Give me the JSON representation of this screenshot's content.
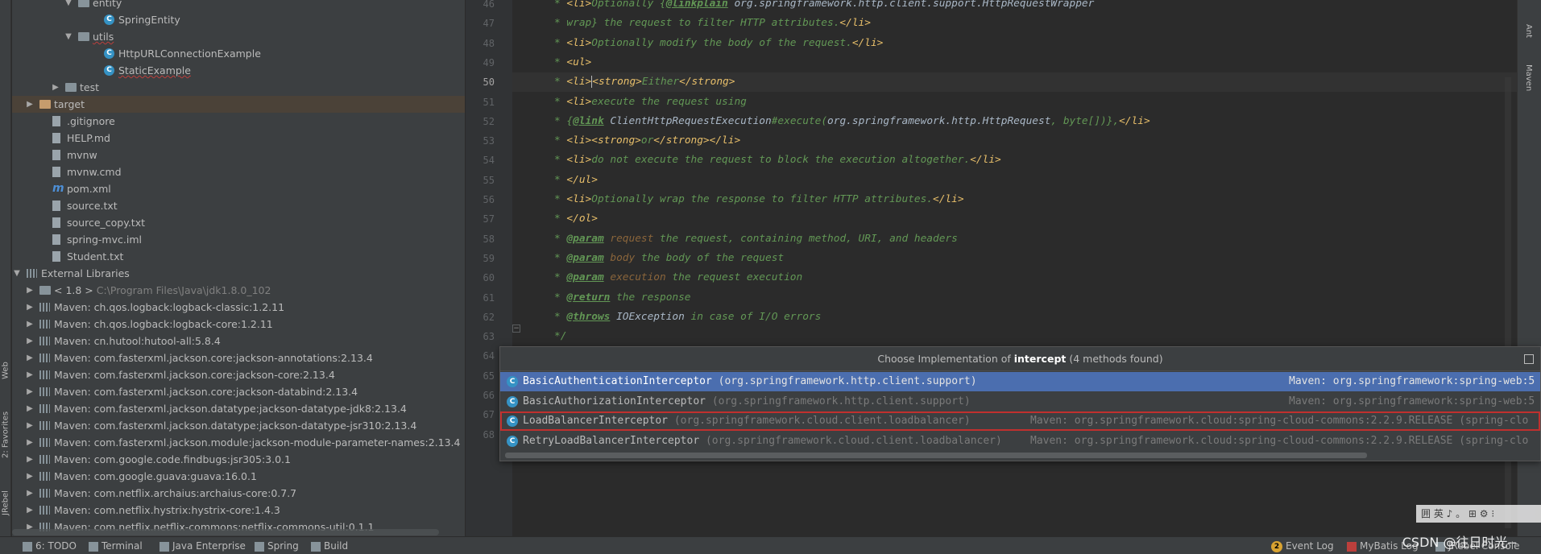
{
  "left_strip": {
    "tabs": [
      "Web",
      "2: Favorites",
      "JRebel"
    ]
  },
  "project_tree": {
    "rows": [
      {
        "label": "entity",
        "type": "folder",
        "indent": 4,
        "arrow": "▼"
      },
      {
        "label": "SpringEntity",
        "type": "class",
        "indent": 6,
        "arrow": ""
      },
      {
        "label": "utils",
        "type": "folder",
        "indent": 4,
        "arrow": "▼"
      },
      {
        "label": "HttpURLConnectionExample",
        "type": "class",
        "indent": 6,
        "arrow": ""
      },
      {
        "label": "StaticExample",
        "type": "class",
        "indent": 6,
        "arrow": ""
      },
      {
        "label": "test",
        "type": "folder",
        "indent": 3,
        "arrow": "▶"
      },
      {
        "label": "target",
        "type": "folder-orange",
        "indent": 1,
        "arrow": "▶"
      },
      {
        "label": ".gitignore",
        "type": "file",
        "indent": 2,
        "arrow": ""
      },
      {
        "label": "HELP.md",
        "type": "file",
        "indent": 2,
        "arrow": ""
      },
      {
        "label": "mvnw",
        "type": "file",
        "indent": 2,
        "arrow": ""
      },
      {
        "label": "mvnw.cmd",
        "type": "file",
        "indent": 2,
        "arrow": ""
      },
      {
        "label": "pom.xml",
        "type": "maven",
        "indent": 2,
        "arrow": ""
      },
      {
        "label": "source.txt",
        "type": "file",
        "indent": 2,
        "arrow": ""
      },
      {
        "label": "source_copy.txt",
        "type": "file",
        "indent": 2,
        "arrow": ""
      },
      {
        "label": "spring-mvc.iml",
        "type": "file",
        "indent": 2,
        "arrow": ""
      },
      {
        "label": "Student.txt",
        "type": "file",
        "indent": 2,
        "arrow": ""
      },
      {
        "label": "External Libraries",
        "type": "lib",
        "indent": 0,
        "arrow": "▼"
      },
      {
        "label": "< 1.8 >",
        "type": "folder",
        "indent": 1,
        "arrow": "▶",
        "extra": "C:\\Program Files\\Java\\jdk1.8.0_102"
      },
      {
        "label": "Maven: ch.qos.logback:logback-classic:1.2.11",
        "type": "lib2",
        "indent": 1,
        "arrow": "▶"
      },
      {
        "label": "Maven: ch.qos.logback:logback-core:1.2.11",
        "type": "lib2",
        "indent": 1,
        "arrow": "▶"
      },
      {
        "label": "Maven: cn.hutool:hutool-all:5.8.4",
        "type": "lib2",
        "indent": 1,
        "arrow": "▶"
      },
      {
        "label": "Maven: com.fasterxml.jackson.core:jackson-annotations:2.13.4",
        "type": "lib2",
        "indent": 1,
        "arrow": "▶"
      },
      {
        "label": "Maven: com.fasterxml.jackson.core:jackson-core:2.13.4",
        "type": "lib2",
        "indent": 1,
        "arrow": "▶"
      },
      {
        "label": "Maven: com.fasterxml.jackson.core:jackson-databind:2.13.4",
        "type": "lib2",
        "indent": 1,
        "arrow": "▶"
      },
      {
        "label": "Maven: com.fasterxml.jackson.datatype:jackson-datatype-jdk8:2.13.4",
        "type": "lib2",
        "indent": 1,
        "arrow": "▶"
      },
      {
        "label": "Maven: com.fasterxml.jackson.datatype:jackson-datatype-jsr310:2.13.4",
        "type": "lib2",
        "indent": 1,
        "arrow": "▶"
      },
      {
        "label": "Maven: com.fasterxml.jackson.module:jackson-module-parameter-names:2.13.4",
        "type": "lib2",
        "indent": 1,
        "arrow": "▶"
      },
      {
        "label": "Maven: com.google.code.findbugs:jsr305:3.0.1",
        "type": "lib2",
        "indent": 1,
        "arrow": "▶"
      },
      {
        "label": "Maven: com.google.guava:guava:16.0.1",
        "type": "lib2",
        "indent": 1,
        "arrow": "▶"
      },
      {
        "label": "Maven: com.netflix.archaius:archaius-core:0.7.7",
        "type": "lib2",
        "indent": 1,
        "arrow": "▶"
      },
      {
        "label": "Maven: com.netflix.hystrix:hystrix-core:1.4.3",
        "type": "lib2",
        "indent": 1,
        "arrow": "▶"
      },
      {
        "label": "Maven: com.netflix.netflix-commons:netflix-commons-util:0.1.1",
        "type": "lib2",
        "indent": 1,
        "arrow": "▶"
      }
    ]
  },
  "editor": {
    "lines": [
      {
        "n": "46",
        "html": "* <span class='tag'>&lt;li&gt;</span>Optionally {<span class='link'>@linkplain</span> <span class='ref'>org.springframework.http.client.support.HttpRequestWrapper</span>"
      },
      {
        "n": "47",
        "html": "* wrap} the request to filter HTTP attributes.<span class='tag'>&lt;/li&gt;</span>"
      },
      {
        "n": "48",
        "html": "* <span class='tag'>&lt;li&gt;</span>Optionally modify the body of the request.<span class='tag'>&lt;/li&gt;</span>"
      },
      {
        "n": "49",
        "html": "* <span class='tag'>&lt;ul&gt;</span>"
      },
      {
        "n": "50",
        "html": "* <span class='tag'>&lt;li&gt;</span><span class='cursor'></span><span class='tag'>&lt;strong&gt;</span>Either<span class='tag'>&lt;/strong&gt;</span>",
        "current": true
      },
      {
        "n": "51",
        "html": "* <span class='tag'>&lt;li&gt;</span>execute the request using"
      },
      {
        "n": "52",
        "html": "* {<span class='link'>@link</span> <span class='ref'>ClientHttpRequestExecution</span>#execute(<span class='ref'>org.springframework.http.HttpRequest</span>, byte[])},<span class='tag'>&lt;/li&gt;</span>"
      },
      {
        "n": "53",
        "html": "* <span class='tag'>&lt;li&gt;&lt;strong&gt;</span>or<span class='tag'>&lt;/strong&gt;&lt;/li&gt;</span>"
      },
      {
        "n": "54",
        "html": "* <span class='tag'>&lt;li&gt;</span>do not execute the request to block the execution altogether.<span class='tag'>&lt;/li&gt;</span>"
      },
      {
        "n": "55",
        "html": "* <span class='tag'>&lt;/ul&gt;</span>"
      },
      {
        "n": "56",
        "html": "* <span class='tag'>&lt;li&gt;</span>Optionally wrap the response to filter HTTP attributes.<span class='tag'>&lt;/li&gt;</span>"
      },
      {
        "n": "57",
        "html": "* <span class='tag'>&lt;/ol&gt;</span>"
      },
      {
        "n": "58",
        "html": "* <span class='kw'>@param</span> <span class='pname'>request</span> the request, containing method, URI, and headers"
      },
      {
        "n": "59",
        "html": "* <span class='kw'>@param</span> <span class='pname'>body</span> the body of the request"
      },
      {
        "n": "60",
        "html": "* <span class='kw'>@param</span> <span class='pname'>execution</span> the request execution"
      },
      {
        "n": "61",
        "html": "* <span class='kw'>@return</span> the response"
      },
      {
        "n": "62",
        "html": "* <span class='kw'>@throws</span> <span class='ref'>IOException</span> in case of I/O errors"
      },
      {
        "n": "63",
        "html": "*/"
      },
      {
        "n": "64",
        "html": ""
      },
      {
        "n": "65",
        "html": ""
      },
      {
        "n": "66",
        "html": ""
      },
      {
        "n": "67",
        "html": ""
      },
      {
        "n": "68",
        "html": ""
      }
    ]
  },
  "right_strip": {
    "tabs": [
      "Ant",
      "Maven"
    ]
  },
  "popup": {
    "title_prefix": "Choose Implementation of ",
    "title_method": "intercept",
    "title_suffix": " (4 methods found)",
    "items": [
      {
        "name": "BasicAuthenticationInterceptor",
        "pkg": "(org.springframework.http.client.support)",
        "source": "Maven: org.springframework:spring-web:5",
        "selected": true,
        "boxed": false
      },
      {
        "name": "BasicAuthorizationInterceptor",
        "pkg": "(org.springframework.http.client.support)",
        "source": "Maven: org.springframework:spring-web:5",
        "selected": false,
        "boxed": false
      },
      {
        "name": "LoadBalancerInterceptor",
        "pkg": "(org.springframework.cloud.client.loadbalancer)",
        "source": "Maven: org.springframework.cloud:spring-cloud-commons:2.2.9.RELEASE (spring-clo",
        "selected": false,
        "boxed": true
      },
      {
        "name": "RetryLoadBalancerInterceptor",
        "pkg": "(org.springframework.cloud.client.loadbalancer)",
        "source": "Maven: org.springframework.cloud:spring-cloud-commons:2.2.9.RELEASE (spring-clo",
        "selected": false,
        "boxed": false
      }
    ]
  },
  "statusbar": {
    "left": [
      "6: TODO",
      "Terminal",
      "Java Enterprise",
      "Spring",
      "Build"
    ],
    "right": [
      "Event Log",
      "MyBatis Log",
      "JRebel Console"
    ],
    "event_badge": "2"
  },
  "watermark": "CSDN @往日时光--",
  "ime": "囲 英 ♪ 。 ⊞ ⚙ ⁝"
}
